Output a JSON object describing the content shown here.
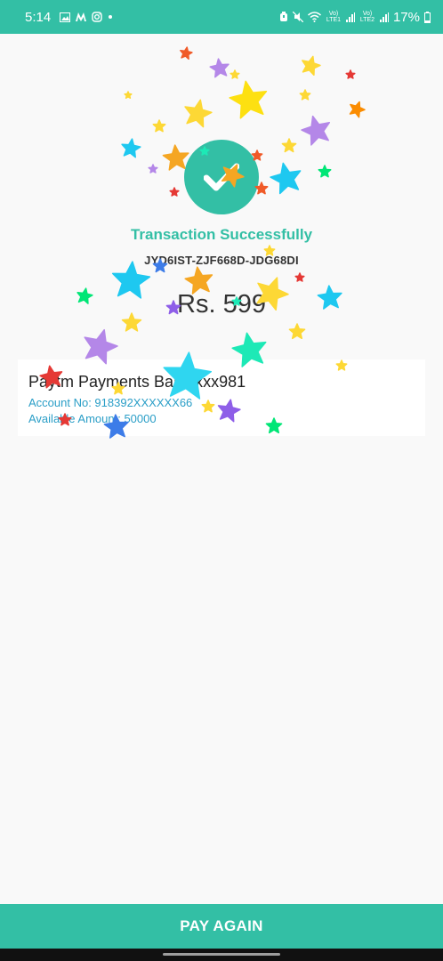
{
  "status_bar": {
    "time": "5:14",
    "notification_icons": [
      "image-icon",
      "m-logo-icon",
      "instagram-icon",
      "dot-icon"
    ],
    "network_1": "Vo) LTE1",
    "network_2": "Vo) LTE2",
    "battery_percent": "17%"
  },
  "success": {
    "icon": "check-icon",
    "title": "Transaction Successfully",
    "transaction_id": "JYD6IST-ZJF668D-JDG68DI",
    "amount": "Rs. 599"
  },
  "bank": {
    "name": "Paytm Payments Bank xxx981",
    "account": "Account No: 918392XXXXXX66",
    "available": "Available Amount: 50000"
  },
  "button": {
    "label": "PAY AGAIN"
  },
  "colors": {
    "primary": "#33bfa5",
    "text_dark": "#333333",
    "link": "#2a9ec7",
    "background": "#f9f9f9"
  }
}
